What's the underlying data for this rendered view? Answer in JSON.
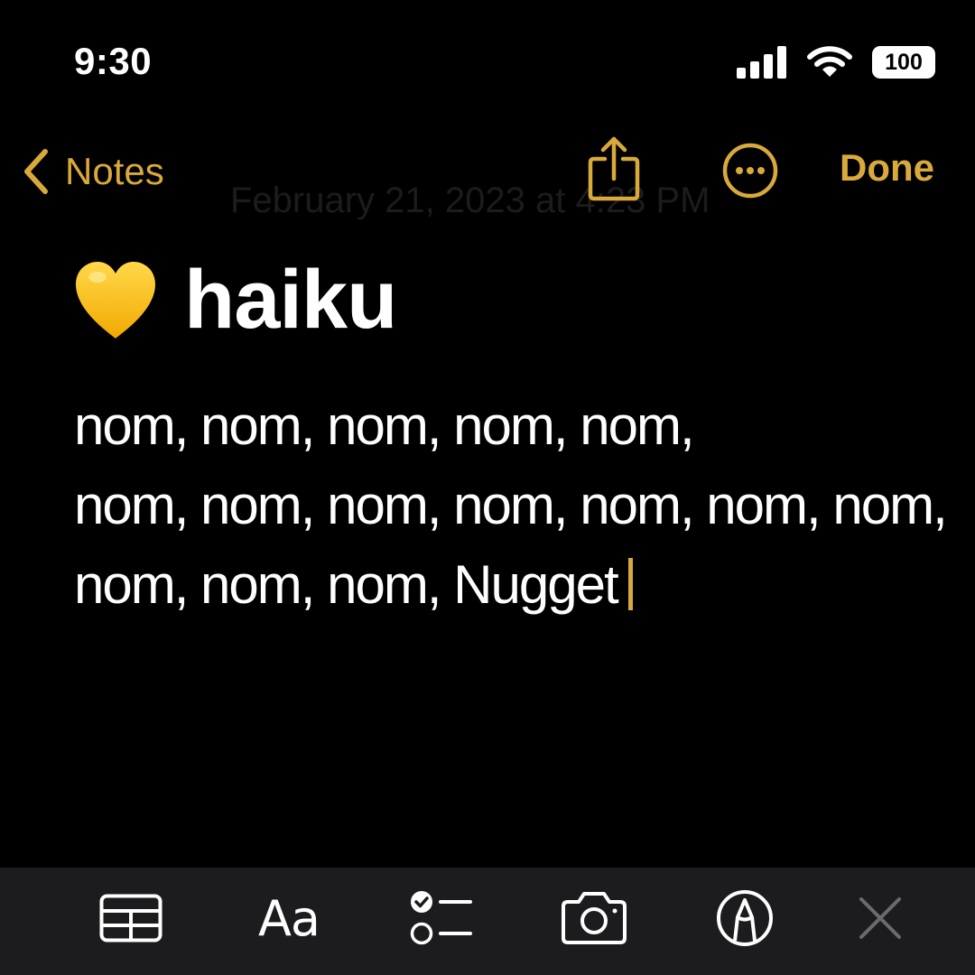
{
  "status_bar": {
    "time": "9:30",
    "battery": "100",
    "icons": [
      "signal-icon",
      "wifi-icon",
      "battery-icon"
    ]
  },
  "nav": {
    "back_label": "Notes",
    "done_label": "Done",
    "faded_date": "February 21, 2023 at 4:23 PM",
    "icons": [
      "chevron-left-icon",
      "share-icon",
      "more-icon"
    ]
  },
  "note": {
    "title_emoji": "yellow-heart-icon",
    "title": "haiku",
    "lines": [
      "nom, nom, nom, nom, nom,",
      "nom, nom, nom, nom, nom, nom, nom,",
      "nom, nom, nom, Nugget"
    ]
  },
  "toolbar": {
    "aa_label": "Aa",
    "icons": [
      "table-icon",
      "text-format-icon",
      "checklist-icon",
      "camera-icon",
      "markup-icon",
      "close-icon"
    ]
  },
  "colors": {
    "accent": "#d9a93b",
    "background": "#000000",
    "toolbar": "#1c1c1e",
    "text": "#ffffff"
  }
}
